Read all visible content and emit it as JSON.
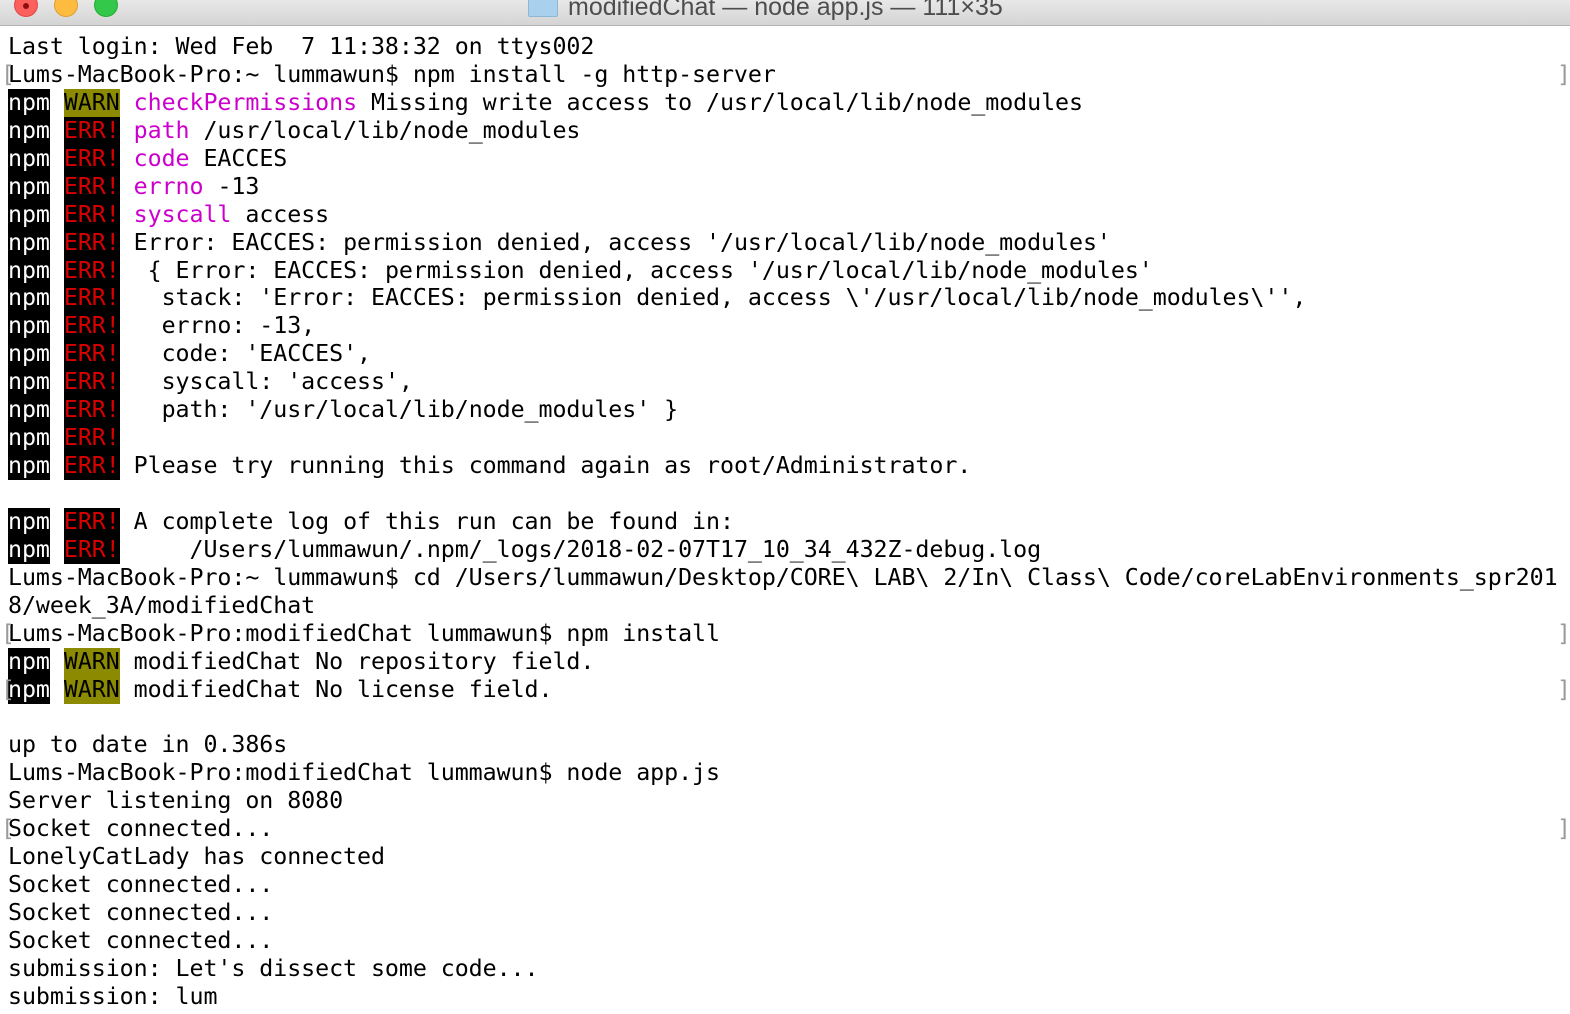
{
  "window": {
    "title": "modifiedChat — node app.js — 111×35",
    "buttons": {
      "close": "close-button",
      "minimize": "minimize-button",
      "zoom": "zoom-button"
    },
    "icon": "folder-icon"
  },
  "colors": {
    "background": "#ffffff",
    "text": "#000000",
    "npm_tag_bg": "#000000",
    "npm_tag_fg": "#ffffff",
    "warn_tag_bg": "#8c8a00",
    "err_tag_fg": "#d90000",
    "keyword_magenta": "#cc00cc"
  },
  "terminal": {
    "lines": [
      {
        "segments": [
          {
            "text": "Last login: Wed Feb  7 11:38:32 on ttys002"
          }
        ]
      },
      {
        "mark": true,
        "segments": [
          {
            "text": "Lums-MacBook-Pro:~ lummawun$ npm install -g http-server"
          }
        ]
      },
      {
        "segments": [
          {
            "text": "npm",
            "style": "npm"
          },
          {
            "text": " "
          },
          {
            "text": "WARN",
            "style": "warn"
          },
          {
            "text": " "
          },
          {
            "text": "checkPermissions",
            "style": "magenta"
          },
          {
            "text": " Missing write access to /usr/local/lib/node_modules"
          }
        ]
      },
      {
        "segments": [
          {
            "text": "npm",
            "style": "npm"
          },
          {
            "text": " "
          },
          {
            "text": "ERR!",
            "style": "err"
          },
          {
            "text": " "
          },
          {
            "text": "path",
            "style": "magenta"
          },
          {
            "text": " /usr/local/lib/node_modules"
          }
        ]
      },
      {
        "segments": [
          {
            "text": "npm",
            "style": "npm"
          },
          {
            "text": " "
          },
          {
            "text": "ERR!",
            "style": "err"
          },
          {
            "text": " "
          },
          {
            "text": "code",
            "style": "magenta"
          },
          {
            "text": " EACCES"
          }
        ]
      },
      {
        "segments": [
          {
            "text": "npm",
            "style": "npm"
          },
          {
            "text": " "
          },
          {
            "text": "ERR!",
            "style": "err"
          },
          {
            "text": " "
          },
          {
            "text": "errno",
            "style": "magenta"
          },
          {
            "text": " -13"
          }
        ]
      },
      {
        "segments": [
          {
            "text": "npm",
            "style": "npm"
          },
          {
            "text": " "
          },
          {
            "text": "ERR!",
            "style": "err"
          },
          {
            "text": " "
          },
          {
            "text": "syscall",
            "style": "magenta"
          },
          {
            "text": " access"
          }
        ]
      },
      {
        "segments": [
          {
            "text": "npm",
            "style": "npm"
          },
          {
            "text": " "
          },
          {
            "text": "ERR!",
            "style": "err"
          },
          {
            "text": " Error: EACCES: permission denied, access '/usr/local/lib/node_modules'"
          }
        ]
      },
      {
        "segments": [
          {
            "text": "npm",
            "style": "npm"
          },
          {
            "text": " "
          },
          {
            "text": "ERR!",
            "style": "err"
          },
          {
            "text": "  { Error: EACCES: permission denied, access '/usr/local/lib/node_modules'"
          }
        ]
      },
      {
        "segments": [
          {
            "text": "npm",
            "style": "npm"
          },
          {
            "text": " "
          },
          {
            "text": "ERR!",
            "style": "err"
          },
          {
            "text": "   stack: 'Error: EACCES: permission denied, access \\'/usr/local/lib/node_modules\\'', "
          }
        ]
      },
      {
        "segments": [
          {
            "text": "npm",
            "style": "npm"
          },
          {
            "text": " "
          },
          {
            "text": "ERR!",
            "style": "err"
          },
          {
            "text": "   errno: -13,"
          }
        ]
      },
      {
        "segments": [
          {
            "text": "npm",
            "style": "npm"
          },
          {
            "text": " "
          },
          {
            "text": "ERR!",
            "style": "err"
          },
          {
            "text": "   code: 'EACCES',"
          }
        ]
      },
      {
        "segments": [
          {
            "text": "npm",
            "style": "npm"
          },
          {
            "text": " "
          },
          {
            "text": "ERR!",
            "style": "err"
          },
          {
            "text": "   syscall: 'access',"
          }
        ]
      },
      {
        "segments": [
          {
            "text": "npm",
            "style": "npm"
          },
          {
            "text": " "
          },
          {
            "text": "ERR!",
            "style": "err"
          },
          {
            "text": "   path: '/usr/local/lib/node_modules' }"
          }
        ]
      },
      {
        "segments": [
          {
            "text": "npm",
            "style": "npm"
          },
          {
            "text": " "
          },
          {
            "text": "ERR!",
            "style": "err"
          }
        ]
      },
      {
        "segments": [
          {
            "text": "npm",
            "style": "npm"
          },
          {
            "text": " "
          },
          {
            "text": "ERR!",
            "style": "err"
          },
          {
            "text": " Please try running this command again as root/Administrator."
          }
        ]
      },
      {
        "segments": []
      },
      {
        "segments": [
          {
            "text": "npm",
            "style": "npm"
          },
          {
            "text": " "
          },
          {
            "text": "ERR!",
            "style": "err"
          },
          {
            "text": " A complete log of this run can be found in:"
          }
        ]
      },
      {
        "segments": [
          {
            "text": "npm",
            "style": "npm"
          },
          {
            "text": " "
          },
          {
            "text": "ERR!",
            "style": "err"
          },
          {
            "text": "     /Users/lummawun/.npm/_logs/2018-02-07T17_10_34_432Z-debug.log"
          }
        ]
      },
      {
        "segments": [
          {
            "text": "Lums-MacBook-Pro:~ lummawun$ cd /Users/lummawun/Desktop/CORE\\ LAB\\ 2/In\\ Class\\ Code/coreLabEnvironments_spr201"
          }
        ]
      },
      {
        "segments": [
          {
            "text": "8/week_3A/modifiedChat"
          }
        ]
      },
      {
        "mark": true,
        "segments": [
          {
            "text": "Lums-MacBook-Pro:modifiedChat lummawun$ npm install"
          }
        ]
      },
      {
        "segments": [
          {
            "text": "npm",
            "style": "npm"
          },
          {
            "text": " "
          },
          {
            "text": "WARN",
            "style": "warn"
          },
          {
            "text": " modifiedChat No repository field."
          }
        ]
      },
      {
        "mark": true,
        "segments": [
          {
            "text": "npm",
            "style": "npm"
          },
          {
            "text": " "
          },
          {
            "text": "WARN",
            "style": "warn"
          },
          {
            "text": " modifiedChat No license field."
          }
        ]
      },
      {
        "segments": []
      },
      {
        "segments": [
          {
            "text": "up to date in 0.386s"
          }
        ]
      },
      {
        "segments": [
          {
            "text": "Lums-MacBook-Pro:modifiedChat lummawun$ node app.js"
          }
        ]
      },
      {
        "segments": [
          {
            "text": "Server listening on 8080"
          }
        ]
      },
      {
        "mark": true,
        "segments": [
          {
            "text": "Socket connected..."
          }
        ]
      },
      {
        "segments": [
          {
            "text": "LonelyCatLady has connected"
          }
        ]
      },
      {
        "segments": [
          {
            "text": "Socket connected..."
          }
        ]
      },
      {
        "segments": [
          {
            "text": "Socket connected..."
          }
        ]
      },
      {
        "segments": [
          {
            "text": "Socket connected..."
          }
        ]
      },
      {
        "segments": [
          {
            "text": "submission: Let's dissect some code..."
          }
        ]
      },
      {
        "segments": [
          {
            "text": "submission: lum"
          }
        ]
      }
    ]
  }
}
